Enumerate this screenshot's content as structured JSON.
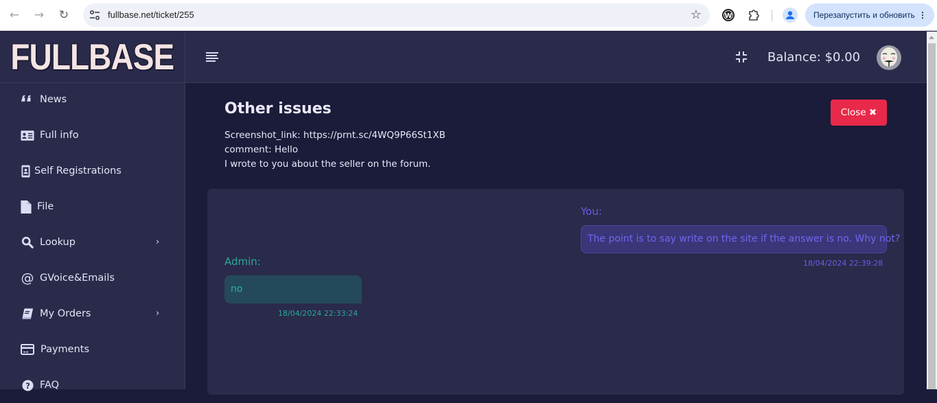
{
  "browser": {
    "url": "fullbase.net/ticket/255",
    "relaunch_label": "Перезапустить и обновить",
    "back_icon": "arrow-left-icon",
    "forward_icon": "arrow-right-icon",
    "reload_icon": "reload-icon",
    "bookmark_icon": "star-icon"
  },
  "logo": {
    "text": "FULLBASE"
  },
  "sidebar": {
    "items": [
      {
        "label": "News",
        "icon": "quote-icon",
        "has_submenu": false
      },
      {
        "label": "Full info",
        "icon": "id-card-icon",
        "has_submenu": false
      },
      {
        "label": "Self Registrations",
        "icon": "id-badge-icon",
        "has_submenu": false
      },
      {
        "label": "File",
        "icon": "file-icon",
        "has_submenu": false
      },
      {
        "label": "Lookup",
        "icon": "search-icon",
        "has_submenu": true
      },
      {
        "label": "GVoice&Emails",
        "icon": "at-icon",
        "has_submenu": false
      },
      {
        "label": "My Orders",
        "icon": "book-icon",
        "has_submenu": true
      },
      {
        "label": "Payments",
        "icon": "credit-card-icon",
        "has_submenu": false
      },
      {
        "label": "FAQ",
        "icon": "question-circle-icon",
        "has_submenu": false
      }
    ],
    "chevron": "›"
  },
  "topbar": {
    "balance": "Balance: $0.00"
  },
  "ticket": {
    "title": "Other issues",
    "lines": [
      "Screenshot_link: https://prnt.sc/4WQ9P66St1XB",
      "comment: Hello",
      "I wrote to you about the seller on the forum."
    ],
    "close_label": "Close ✖"
  },
  "chat": {
    "messages": [
      {
        "author": "You:",
        "text": "The point is to say write on the site if the answer is no. Why not?",
        "time": "18/04/2024 22:39:28"
      },
      {
        "author": "Admin:",
        "text": "no",
        "time": "18/04/2024 22:33:24"
      }
    ]
  },
  "colors": {
    "accent_close": "#e9294a",
    "you_text": "#6a5ce8",
    "admin_text": "#2aa89a",
    "sidebar_bg": "#2a2a4a",
    "main_bg": "#1b1b3a"
  }
}
